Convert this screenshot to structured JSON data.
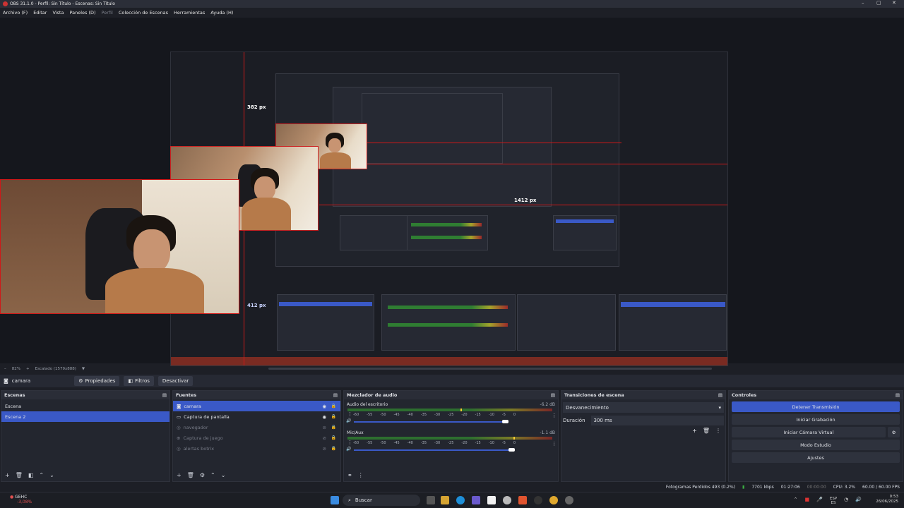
{
  "window": {
    "title": "OBS 31.1.0 - Perfil: Sin Título - Escenas: Sin Título",
    "min": "–",
    "max": "▢",
    "close": "✕"
  },
  "menu": [
    "Archivo (F)",
    "Editar",
    "Vista",
    "Paneles (D)",
    "Perfil",
    "Colección de Escenas",
    "Herramientas",
    "Ayuda (H)"
  ],
  "preview": {
    "measure_v1": "382 px",
    "measure_h1": "412 px",
    "measure_h2": "1412 px",
    "measure_h3": "1412 px"
  },
  "preview_status": {
    "zoom": "82%",
    "scale": "Escalado (1579x888)"
  },
  "toolbar": {
    "source": "camara",
    "properties": "Propiedades",
    "filters": "Filtros",
    "deactivate": "Desactivar"
  },
  "scenes": {
    "title": "Escenas",
    "items": [
      "Escena",
      "Escena 2"
    ],
    "selected": 1
  },
  "sources": {
    "title": "Fuentes",
    "items": [
      {
        "name": "camara",
        "icon": "camera-icon",
        "visible": true,
        "selected": true
      },
      {
        "name": "Captura de pantalla",
        "icon": "monitor-icon",
        "visible": true,
        "selected": false
      },
      {
        "name": "navegador",
        "icon": "globe-icon",
        "visible": false,
        "selected": false
      },
      {
        "name": "Captura de juego",
        "icon": "gamepad-icon",
        "visible": false,
        "selected": false
      },
      {
        "name": "alertas botrix",
        "icon": "globe-icon",
        "visible": false,
        "selected": false
      }
    ]
  },
  "mixer": {
    "title": "Mezclador de audio",
    "channels": [
      {
        "name": "Audio del escritorio",
        "db": "-6.2 dB",
        "level": 0.55,
        "volume": 0.93
      },
      {
        "name": "Mic/Aux",
        "db": "-1.1 dB",
        "level": 0.81,
        "volume": 0.97
      }
    ],
    "ticks": [
      "-60",
      "-55",
      "-50",
      "-45",
      "-40",
      "-35",
      "-30",
      "-25",
      "-20",
      "-15",
      "-10",
      "-5",
      "0"
    ]
  },
  "transitions": {
    "title": "Transiciones de escena",
    "selected": "Desvanecimiento",
    "duration_label": "Duración",
    "duration": "300 ms"
  },
  "controls": {
    "title": "Controles",
    "stop_stream": "Detener Transmisión",
    "start_rec": "Iniciar Grabación",
    "virtual_cam": "Iniciar Cámara Virtual",
    "studio": "Modo Estudio",
    "settings": "Ajustes"
  },
  "status": {
    "dropped": "Fotogramas Perdidos 493 (0.2%)",
    "bitrate": "7701 kbps",
    "stream_time": "01:27:06",
    "rec_time": "00:00:00",
    "cpu": "CPU: 3.2%",
    "fps": "60.00 / 60.00 FPS"
  },
  "taskbar": {
    "ticker": "GEHC",
    "ticker_change": "-3,08%",
    "search": "Buscar",
    "lang": "ESP",
    "region": "ES",
    "time": "0:53",
    "date": "26/06/2025"
  }
}
